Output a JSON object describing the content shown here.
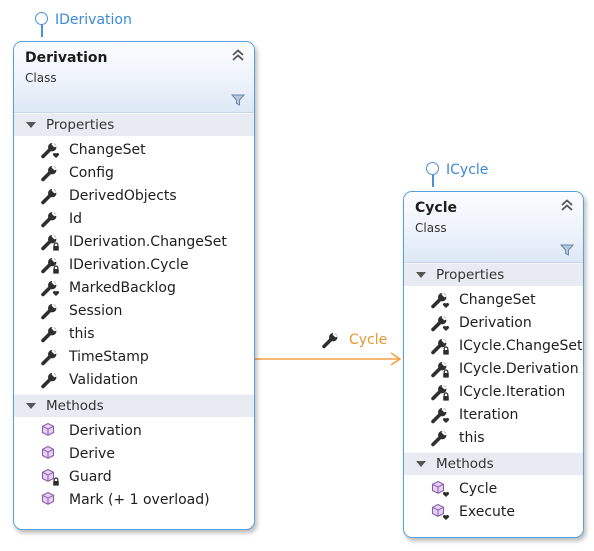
{
  "colors": {
    "border": "#5aa0e0",
    "interface": "#3a8ad6",
    "association": "#f0a040",
    "association_label": "#e69a2e",
    "section_bg": "#e8ecf2"
  },
  "derivation": {
    "interface": "IDerivation",
    "title": "Derivation",
    "kind": "Class",
    "properties_label": "Properties",
    "methods_label": "Methods",
    "properties": [
      {
        "name": "ChangeSet",
        "icon": "wrench-heart-icon"
      },
      {
        "name": "Config",
        "icon": "wrench-icon"
      },
      {
        "name": "DerivedObjects",
        "icon": "wrench-icon"
      },
      {
        "name": "Id",
        "icon": "wrench-icon"
      },
      {
        "name": "IDerivation.ChangeSet",
        "icon": "wrench-lock-icon"
      },
      {
        "name": "IDerivation.Cycle",
        "icon": "wrench-lock-icon"
      },
      {
        "name": "MarkedBacklog",
        "icon": "wrench-heart-icon"
      },
      {
        "name": "Session",
        "icon": "wrench-icon"
      },
      {
        "name": "this",
        "icon": "wrench-icon"
      },
      {
        "name": "TimeStamp",
        "icon": "wrench-icon"
      },
      {
        "name": "Validation",
        "icon": "wrench-icon"
      }
    ],
    "methods": [
      {
        "name": "Derivation",
        "icon": "cube-icon"
      },
      {
        "name": "Derive",
        "icon": "cube-icon"
      },
      {
        "name": "Guard",
        "icon": "cube-lock-icon"
      },
      {
        "name": "Mark (+ 1 overload)",
        "icon": "cube-icon"
      }
    ]
  },
  "cycle": {
    "interface": "ICycle",
    "title": "Cycle",
    "kind": "Class",
    "properties_label": "Properties",
    "methods_label": "Methods",
    "properties": [
      {
        "name": "ChangeSet",
        "icon": "wrench-heart-icon"
      },
      {
        "name": "Derivation",
        "icon": "wrench-heart-icon"
      },
      {
        "name": "ICycle.ChangeSet",
        "icon": "wrench-lock-icon"
      },
      {
        "name": "ICycle.Derivation",
        "icon": "wrench-lock-icon"
      },
      {
        "name": "ICycle.Iteration",
        "icon": "wrench-lock-icon"
      },
      {
        "name": "Iteration",
        "icon": "wrench-heart-icon"
      },
      {
        "name": "this",
        "icon": "wrench-icon"
      }
    ],
    "methods": [
      {
        "name": "Cycle",
        "icon": "cube-heart-icon"
      },
      {
        "name": "Execute",
        "icon": "cube-heart-icon"
      }
    ]
  },
  "association": {
    "label": "Cycle",
    "icon": "wrench-icon"
  }
}
